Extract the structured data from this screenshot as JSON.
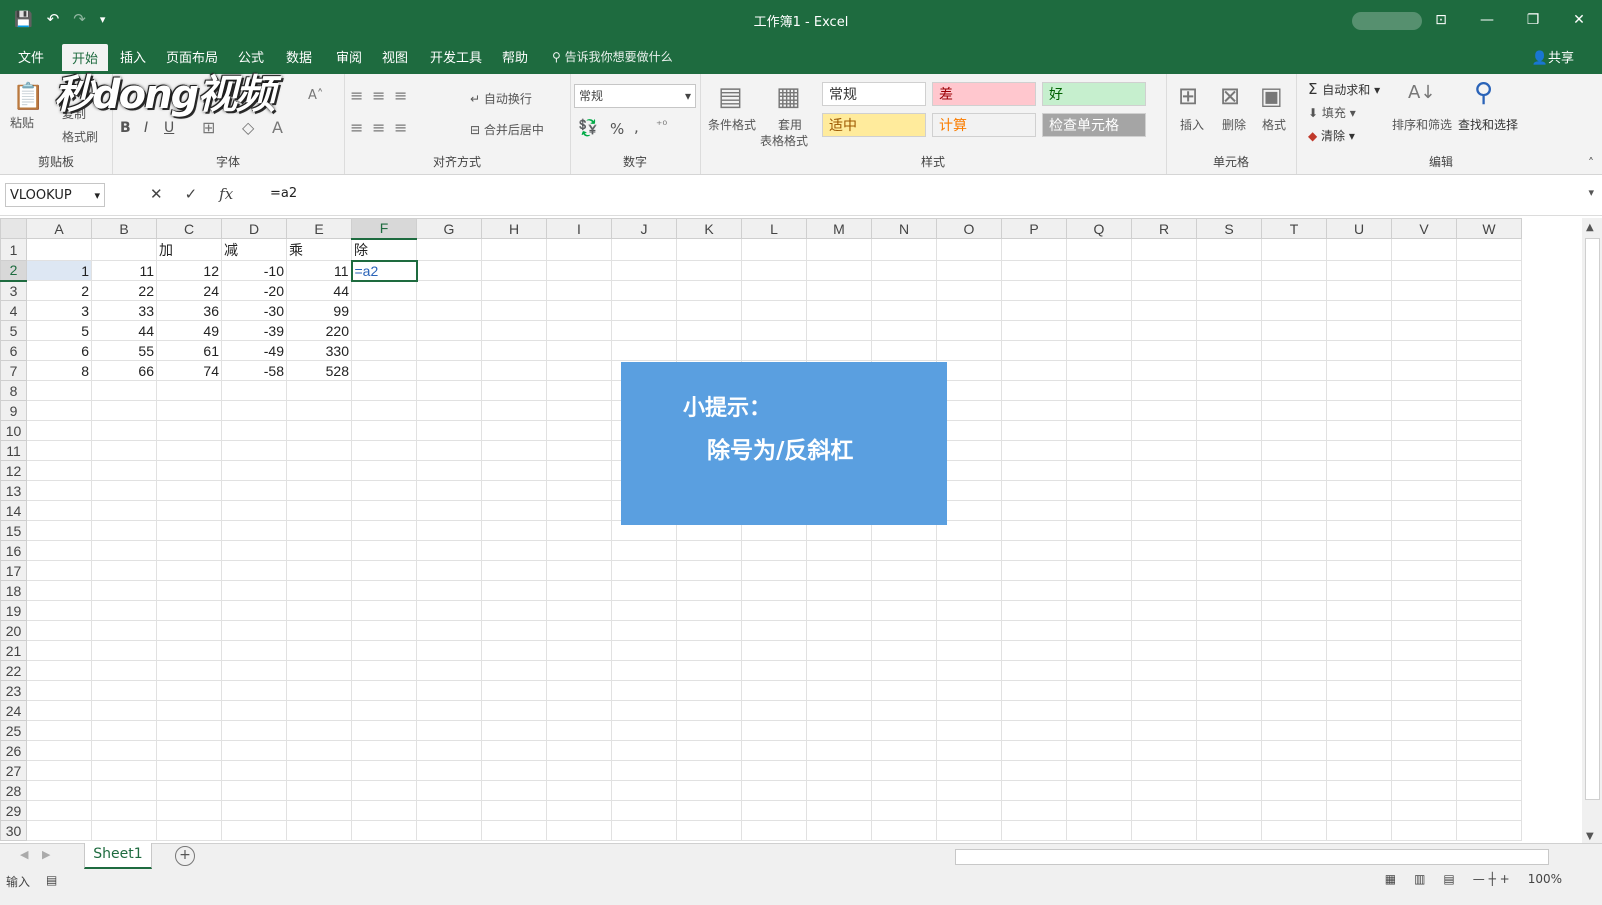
{
  "window": {
    "title": "工作簿1 - Excel"
  },
  "menu": {
    "tabs": [
      "文件",
      "开始",
      "插入",
      "页面布局",
      "公式",
      "数据",
      "审阅",
      "视图",
      "开发工具",
      "帮助"
    ],
    "active": "开始",
    "tell_me": "告诉我你想要做什么",
    "share": "共享"
  },
  "ribbon": {
    "clipboard": {
      "paste": "粘贴",
      "copy": "复制",
      "format_painter": "格式刷",
      "label": "剪贴板"
    },
    "font": {
      "label": "字体",
      "bold": "B",
      "italic": "I",
      "underline": "U"
    },
    "alignment": {
      "wrap": "自动换行",
      "merge": "合并后居中",
      "label": "对齐方式"
    },
    "number": {
      "format": "常规",
      "label": "数字",
      "percent": "%",
      "comma": ","
    },
    "styles": {
      "conditional": "条件格式",
      "table_format_1": "套用",
      "table_format_2": "表格格式",
      "label": "样式",
      "cells": [
        {
          "text": "常规",
          "bg": "#ffffff",
          "fg": "#333333"
        },
        {
          "text": "差",
          "bg": "#ffc7ce",
          "fg": "#9c0006"
        },
        {
          "text": "好",
          "bg": "#c6efce",
          "fg": "#006100"
        },
        {
          "text": "适中",
          "bg": "#ffeb9c",
          "fg": "#9c5700"
        },
        {
          "text": "计算",
          "bg": "#f2f2f2",
          "fg": "#fa7d00"
        },
        {
          "text": "检查单元格",
          "bg": "#a5a5a5",
          "fg": "#ffffff"
        }
      ]
    },
    "cells": {
      "insert": "插入",
      "delete": "删除",
      "format": "格式",
      "label": "单元格"
    },
    "editing": {
      "autosum": "自动求和",
      "fill": "填充",
      "clear": "清除",
      "sort": "排序和筛选",
      "find": "查找和选择",
      "label": "编辑"
    }
  },
  "logo": "秒dong视频",
  "formula_bar": {
    "name_box": "VLOOKUP",
    "value": "=a2",
    "fx": "fx"
  },
  "sheet": {
    "columns": [
      "A",
      "B",
      "C",
      "D",
      "E",
      "F",
      "G",
      "H",
      "I",
      "J",
      "K",
      "L",
      "M",
      "N",
      "O",
      "P",
      "Q",
      "R",
      "S",
      "T",
      "U",
      "V",
      "W"
    ],
    "row_count": 30,
    "headers_row1": {
      "C": "加",
      "D": "减",
      "E": "乘",
      "F": "除"
    },
    "data": [
      [
        "1",
        "11",
        "12",
        "-10",
        "11",
        "=a2"
      ],
      [
        "2",
        "22",
        "24",
        "-20",
        "44",
        ""
      ],
      [
        "3",
        "33",
        "36",
        "-30",
        "99",
        ""
      ],
      [
        "5",
        "44",
        "49",
        "-39",
        "220",
        ""
      ],
      [
        "6",
        "55",
        "61",
        "-49",
        "330",
        ""
      ],
      [
        "8",
        "66",
        "74",
        "-58",
        "528",
        ""
      ]
    ]
  },
  "tip": {
    "title": "小提示：",
    "body": "除号为/反斜杠"
  },
  "tabs": {
    "sheet1": "Sheet1",
    "add": "+"
  },
  "status": {
    "mode": "输入",
    "zoom": "100%"
  }
}
